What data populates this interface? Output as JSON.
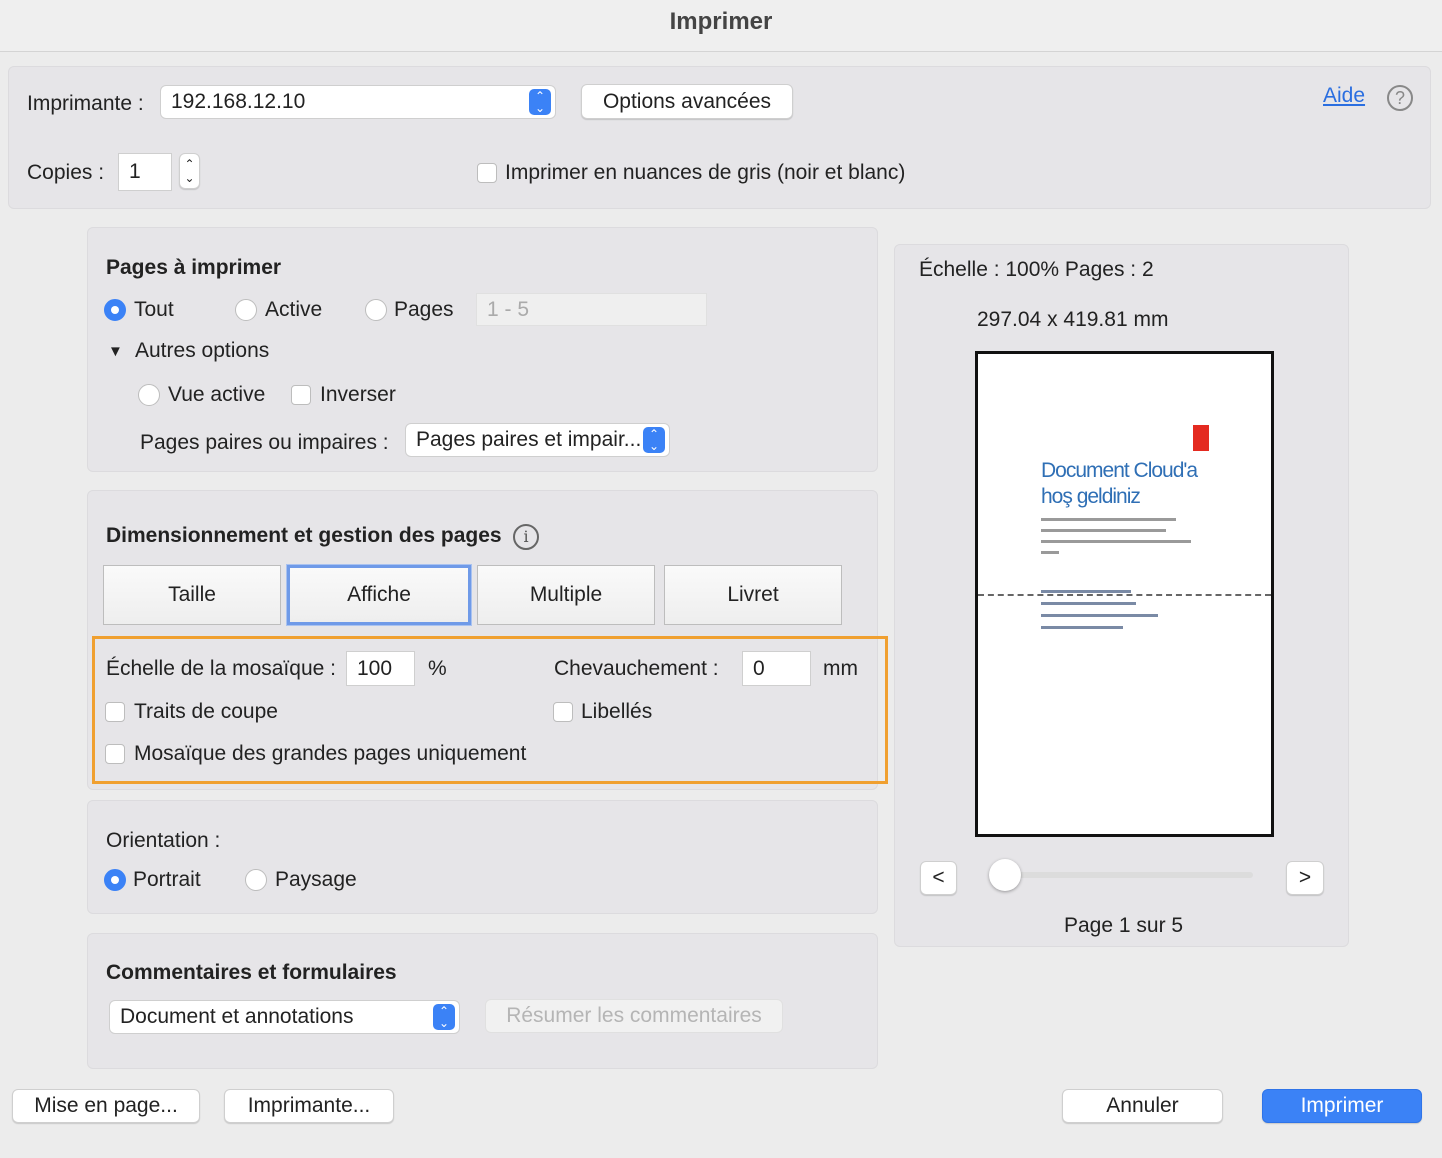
{
  "window": {
    "title": "Imprimer"
  },
  "top": {
    "printer_label": "Imprimante :",
    "printer_value": "192.168.12.10",
    "advanced_button": "Options avancées",
    "help_link": "Aide",
    "help_icon": "?",
    "copies_label": "Copies :",
    "copies_value": "1",
    "grayscale_label": "Imprimer en nuances de gris (noir et blanc)"
  },
  "pages": {
    "title": "Pages à imprimer",
    "all": "Tout",
    "active": "Active",
    "pages": "Pages",
    "range_placeholder": "1 - 5",
    "more_options": "Autres options",
    "active_view": "Vue active",
    "reverse": "Inverser",
    "odd_even_label": "Pages paires ou impaires :",
    "odd_even_value": "Pages paires et impair..."
  },
  "sizing": {
    "title": "Dimensionnement et gestion des pages",
    "tabs": [
      "Taille",
      "Affiche",
      "Multiple",
      "Livret"
    ],
    "selected_tab": "Affiche",
    "tile_scale_label": "Échelle de la mosaïque :",
    "tile_scale_value": "100",
    "percent": "%",
    "overlap_label": "Chevauchement :",
    "overlap_value": "0",
    "overlap_unit": "mm",
    "cut_marks": "Traits de coupe",
    "labels": "Libellés",
    "tile_large_only": "Mosaïque des grandes pages uniquement"
  },
  "orientation": {
    "title": "Orientation :",
    "portrait": "Portrait",
    "landscape": "Paysage"
  },
  "comments": {
    "title": "Commentaires et formulaires",
    "select_value": "Document et annotations",
    "summarize_button": "Résumer les commentaires"
  },
  "preview": {
    "scale_text": "Échelle : 100% Pages : 2",
    "dimensions": "297.04 x 419.81 mm",
    "doc_heading_1": "Document Cloud'a",
    "doc_heading_2": "hoş geldiniz",
    "prev": "<",
    "next": ">",
    "page_indicator": "Page 1 sur 5",
    "slider_fraction": 0
  },
  "footer": {
    "page_setup": "Mise en page...",
    "printer": "Imprimante...",
    "cancel": "Annuler",
    "print": "Imprimer"
  },
  "colors": {
    "accent": "#3b82f6",
    "highlight": "#f0a030",
    "adobe_red": "#e42a20",
    "doc_blue": "#2f6fb5"
  }
}
